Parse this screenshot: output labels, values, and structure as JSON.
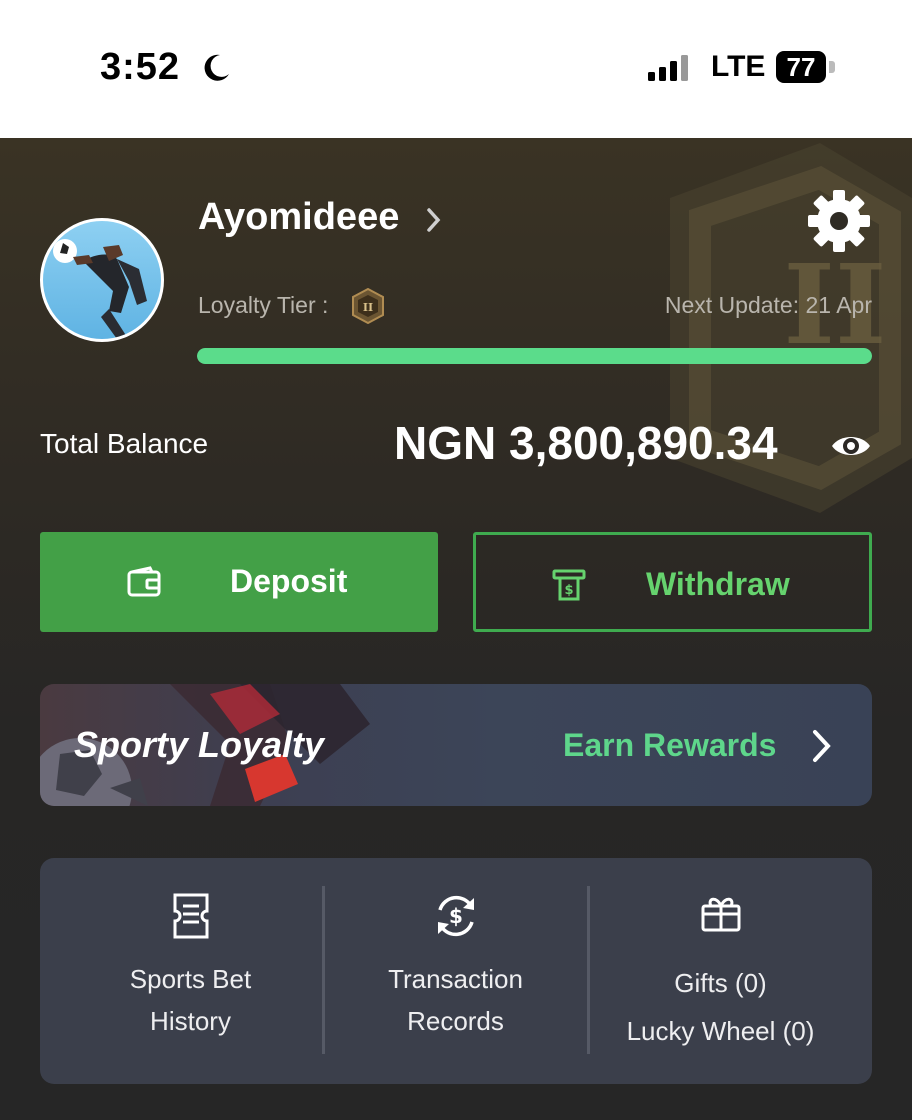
{
  "status_bar": {
    "time": "3:52",
    "network": "LTE",
    "battery": "77"
  },
  "profile": {
    "username": "Ayomideee",
    "loyalty_tier_label": "Loyalty Tier :",
    "tier_badge": "II",
    "next_update": "Next Update: 21 Apr",
    "tier_progress": 1.0
  },
  "balance": {
    "label": "Total Balance",
    "value": "NGN 3,800,890.34"
  },
  "actions": {
    "deposit_label": "Deposit",
    "withdraw_label": "Withdraw"
  },
  "banner": {
    "title": "Sporty Loyalty",
    "cta": "Earn Rewards"
  },
  "quick_links": [
    {
      "line1": "Sports Bet",
      "line2": "History",
      "icon": "ticket-icon"
    },
    {
      "line1": "Transaction",
      "line2": "Records",
      "icon": "dollar-refresh-icon"
    },
    {
      "line1": "Gifts (0)",
      "line2": "Lucky Wheel (0)",
      "icon": "gift-icon"
    }
  ],
  "colors": {
    "accent_green": "#43a047",
    "progress": "#5bdc8b",
    "earn_text": "#5ed68b"
  }
}
